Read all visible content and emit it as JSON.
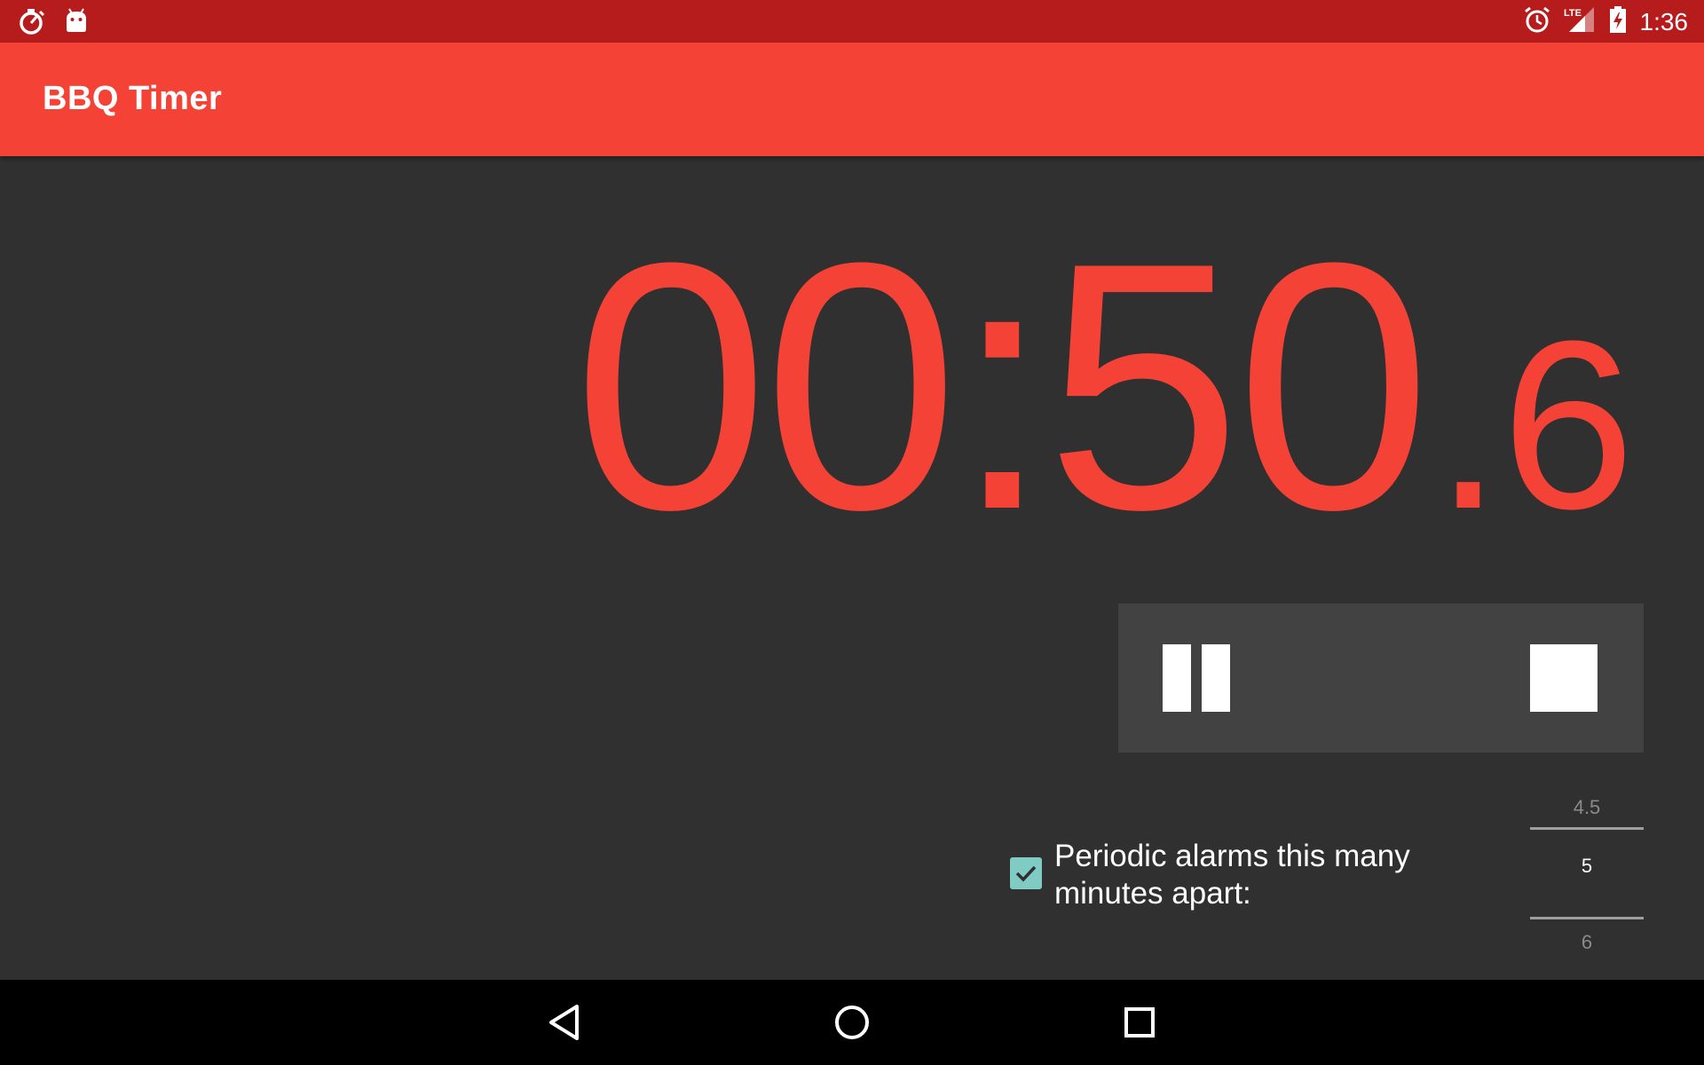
{
  "status_bar": {
    "time": "1:36",
    "network": "LTE",
    "left_icons": [
      "stopwatch-icon",
      "android-icon"
    ],
    "right_icons": [
      "alarm-clock-icon",
      "lte-signal-icon",
      "battery-charging-icon"
    ]
  },
  "app_bar": {
    "title": "BBQ Timer",
    "color": "#f44336",
    "status_color": "#b71c1c"
  },
  "timer": {
    "main": "00:50",
    "fraction": ".6",
    "color": "#f44336"
  },
  "controls": {
    "pause_icon": "pause-icon",
    "stop_icon": "stop-icon"
  },
  "alarm": {
    "checked": true,
    "label_line1": "Periodic alarms this many",
    "label_line2": "minutes apart:",
    "checkbox_color": "#80cbc4"
  },
  "picker": {
    "previous": "4.5",
    "current": "5",
    "next": "6"
  },
  "nav_bar": {
    "icons": [
      "back-icon",
      "home-icon",
      "recents-icon"
    ]
  }
}
